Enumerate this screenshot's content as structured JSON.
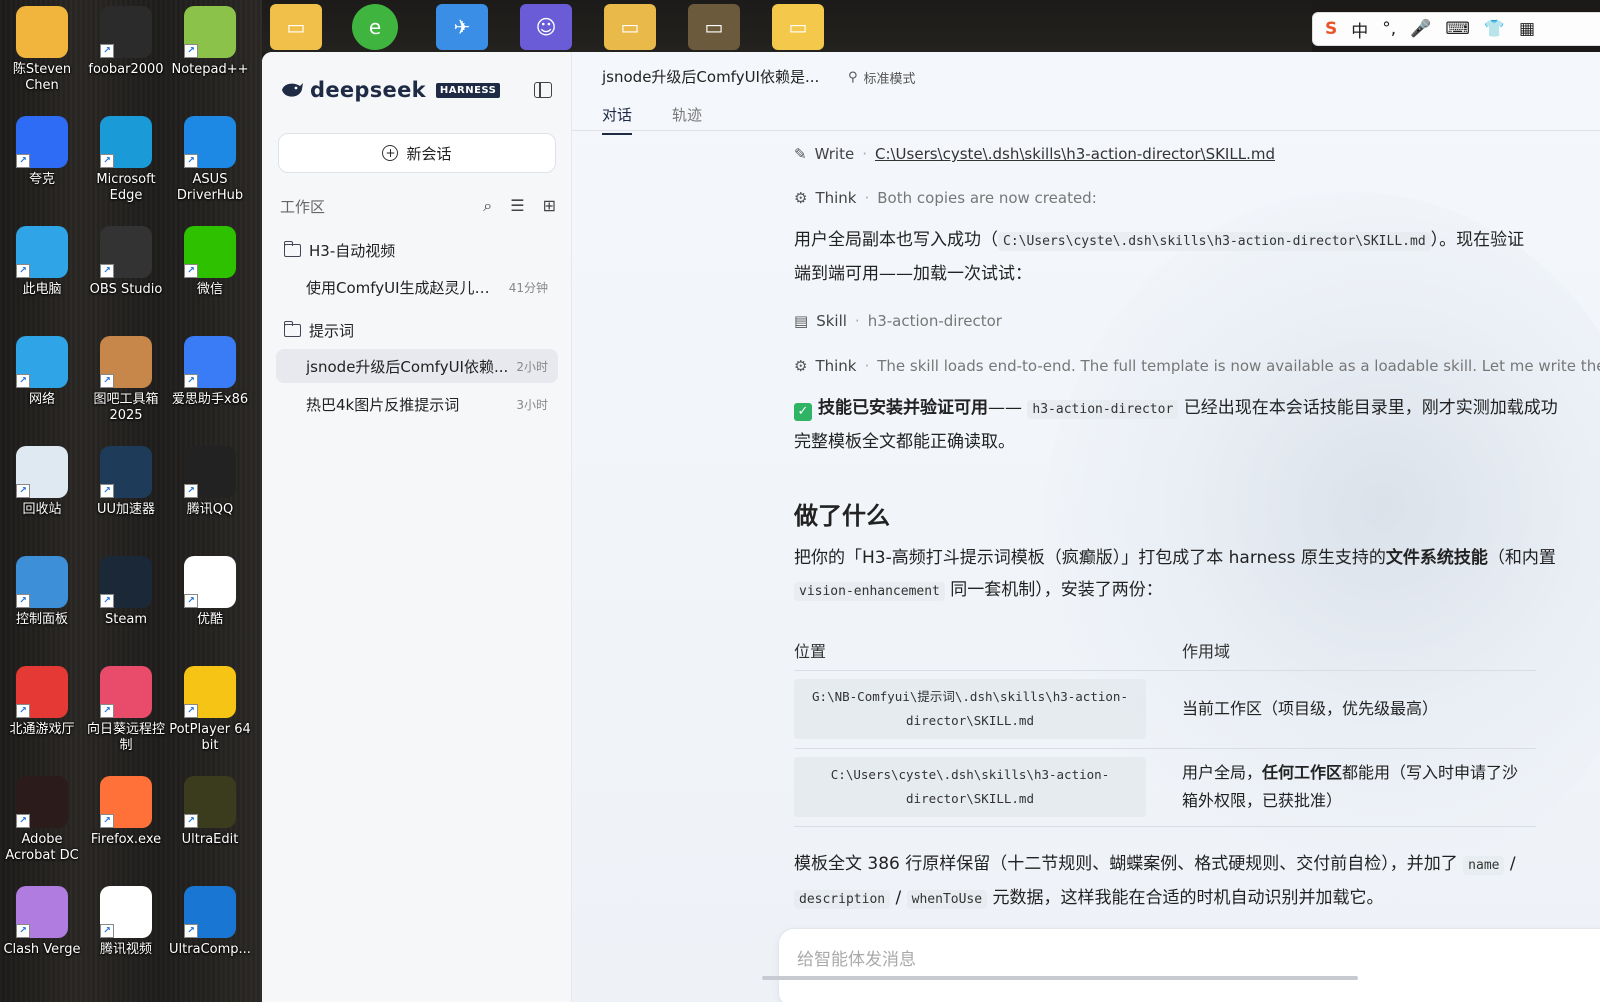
{
  "desktop": {
    "icons": [
      {
        "label": "陈Steven\nChen",
        "icon": "user-folder-icon",
        "color": "#f1b53d"
      },
      {
        "label": "foobar2000",
        "icon": "foobar-icon",
        "color": "#2b2b2b"
      },
      {
        "label": "Notepad++",
        "icon": "notepad-icon",
        "color": "#8bc34a"
      },
      {
        "label": "夸克",
        "icon": "quark-icon",
        "color": "#2e6cf6"
      },
      {
        "label": "Microsoft\nEdge",
        "icon": "edge-icon",
        "color": "#1a9bd7"
      },
      {
        "label": "ASUS\nDriverHub",
        "icon": "gear-icon",
        "color": "#1e88e5"
      },
      {
        "label": "此电脑",
        "icon": "computer-icon",
        "color": "#2fa4e7"
      },
      {
        "label": "OBS Studio",
        "icon": "obs-icon",
        "color": "#333333"
      },
      {
        "label": "微信",
        "icon": "wechat-icon",
        "color": "#2dc100"
      },
      {
        "label": "网络",
        "icon": "network-icon",
        "color": "#2fa4e7"
      },
      {
        "label": "图吧工具箱\n2025",
        "icon": "toolbox-icon",
        "color": "#c7874a"
      },
      {
        "label": "爱思助手x86",
        "icon": "i4-icon",
        "color": "#3a7bf6"
      },
      {
        "label": "回收站",
        "icon": "recycle-bin-icon",
        "color": "#dfe9f2"
      },
      {
        "label": "UU加速器",
        "icon": "uu-icon",
        "color": "#1f3b5a"
      },
      {
        "label": "腾讯QQ",
        "icon": "qq-icon",
        "color": "#222222"
      },
      {
        "label": "控制面板",
        "icon": "control-panel-icon",
        "color": "#3d8fd8"
      },
      {
        "label": "Steam",
        "icon": "steam-icon",
        "color": "#1b2838"
      },
      {
        "label": "优酷",
        "icon": "youku-icon",
        "color": "#ffffff"
      },
      {
        "label": "北通游戏厅",
        "icon": "betop-icon",
        "color": "#e53935"
      },
      {
        "label": "向日葵远程控\n制",
        "icon": "sunlogin-icon",
        "color": "#e94b6a"
      },
      {
        "label": "PotPlayer 64\nbit",
        "icon": "potplayer-icon",
        "color": "#f6c414"
      },
      {
        "label": "Adobe\nAcrobat DC",
        "icon": "acrobat-icon",
        "color": "#2b1b1b"
      },
      {
        "label": "Firefox.exe",
        "icon": "firefox-icon",
        "color": "#ff7139"
      },
      {
        "label": "UltraEdit",
        "icon": "ultraedit-icon",
        "color": "#3b3b1e"
      },
      {
        "label": "Clash Verge",
        "icon": "clash-icon",
        "color": "#b07ce0"
      },
      {
        "label": "腾讯视频",
        "icon": "tencent-video-icon",
        "color": "#ffffff"
      },
      {
        "label": "UltraComp...",
        "icon": "ultracompare-icon",
        "color": "#1976d2"
      }
    ],
    "ime": {
      "items": [
        "S",
        "中",
        "°,",
        "🎤",
        "⌨",
        "👕",
        "▦"
      ]
    }
  },
  "sidebar": {
    "brand": "deepseek",
    "badge": "HARNESS",
    "new_chat": "新会话",
    "workspace_label": "工作区",
    "folders": [
      {
        "name": "H3-自动视频",
        "conversations": [
          {
            "title": "使用ComfyUI生成赵灵儿大...",
            "time": "41分钟",
            "active": false
          }
        ]
      },
      {
        "name": "提示词",
        "conversations": [
          {
            "title": "jsnode升级后ComfyUI依赖...",
            "time": "2小时",
            "active": true
          },
          {
            "title": "热巴4k图片反推提示词",
            "time": "3小时",
            "active": false
          }
        ]
      }
    ]
  },
  "main": {
    "title": "jsnode升级后ComfyUI依赖是...",
    "mode": "标准模式",
    "tabs": [
      "对话",
      "轨迹"
    ],
    "steps": [
      {
        "kind": "Write",
        "detail": "C:\\Users\\cyste\\.dsh\\skills\\h3-action-director\\SKILL.md"
      },
      {
        "kind": "Think",
        "detail": "Both copies are now created:"
      },
      {
        "kind": "Skill",
        "detail": "h3-action-director"
      },
      {
        "kind": "Think",
        "detail": "The skill loads end-to-end. The full template is now available as a loadable skill. Let me write the final"
      }
    ],
    "para1_a": "用户全局副本也写入成功（",
    "para1_code": "C:\\Users\\cyste\\.dsh\\skills\\h3-action-director\\SKILL.md",
    "para1_b": "）。现在验证",
    "para1_c": "端到端可用——加载一次试试：",
    "check_bold": "技能已安装并验证可用",
    "check_dash": "——",
    "check_code": "h3-action-director",
    "check_rest": "已经出现在本会话技能目录里，刚才实测加载成功",
    "check_line2": "完整模板全文都能正确读取。",
    "section_title": "做了什么",
    "para2_a": "把你的「H3-高频打斗提示词模板（疯癫版）」打包成了本 harness 原生支持的",
    "para2_bold": "文件系统技能",
    "para2_b": "（和内置",
    "para2_code": "vision-enhancement",
    "para2_c": "同一套机制），安装了两份：",
    "table": {
      "headers": [
        "位置",
        "作用域"
      ],
      "rows": [
        {
          "path": "G:\\NB-Comfyui\\提示词\\.dsh\\skills\\h3-action-\ndirector\\SKILL.md",
          "scope_a": "当前工作区（项目级，优先级最高）",
          "scope_bold": "",
          "scope_b": "",
          "scope_c": ""
        },
        {
          "path": "C:\\Users\\cyste\\.dsh\\skills\\h3-action-\ndirector\\SKILL.md",
          "scope_a": "用户全局，",
          "scope_bold": "任何工作区",
          "scope_b": "都能用（写入时申请了沙",
          "scope_c": "箱外权限，已获批准）"
        }
      ]
    },
    "para3_a": "模板全文 386 行原样保留（十二节规则、蝴蝶案例、格式硬规则、交付前自检），并加了",
    "para3_code1": "name",
    "para3_slash1": "/",
    "para3_code2": "description",
    "para3_slash2": "/",
    "para3_code3": "whenToUse",
    "para3_b": "元数据，这样我能在合适的时机自动识别并加载它。",
    "composer_placeholder": "给智能体发消息"
  }
}
